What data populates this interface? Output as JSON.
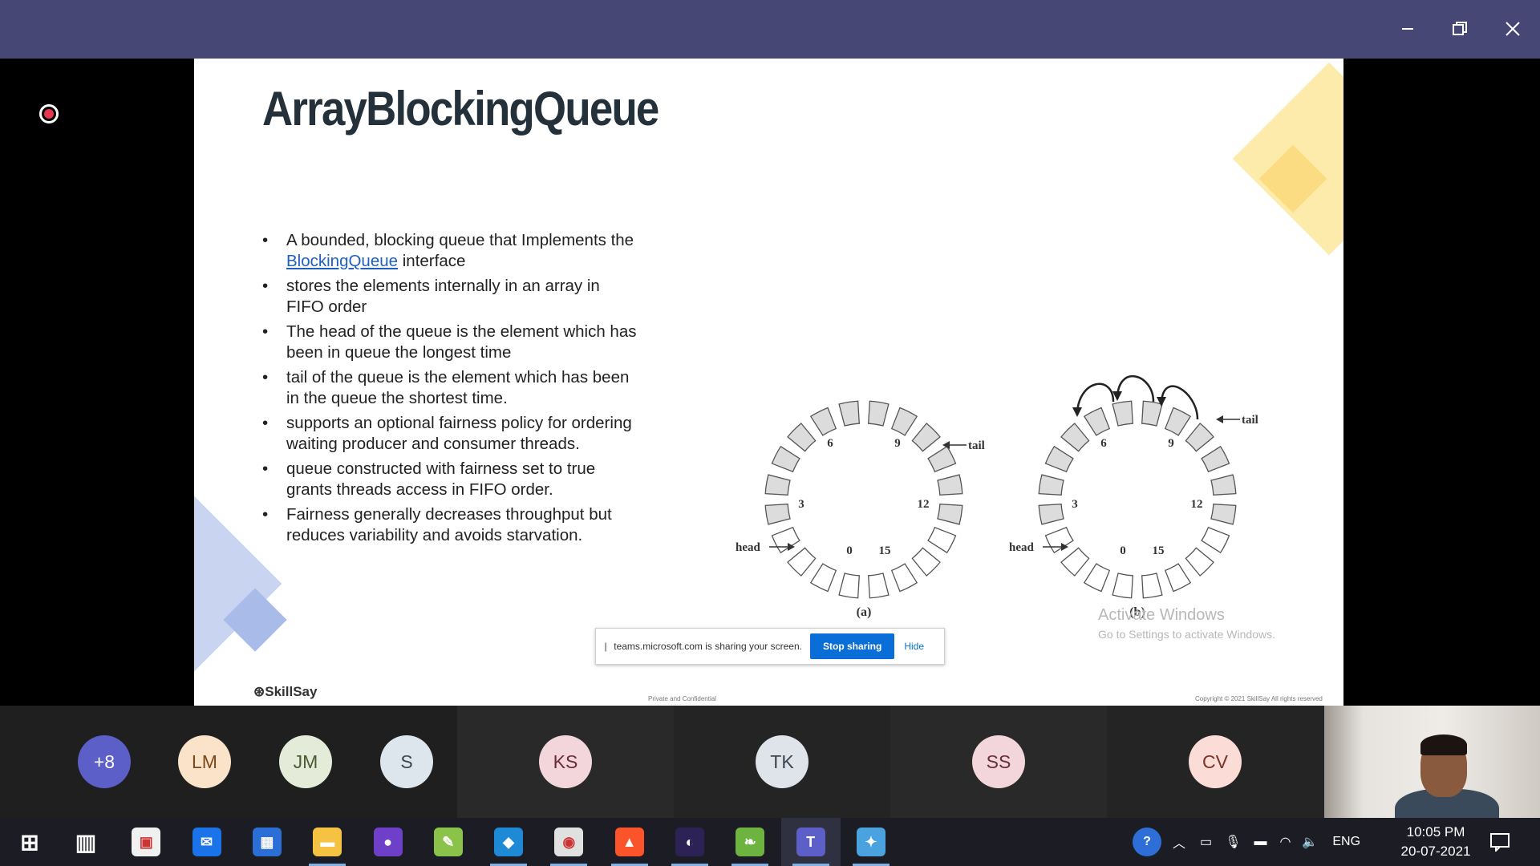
{
  "window": {
    "minimize_icon": "minimize-icon",
    "restore_icon": "restore-icon",
    "close_icon": "close-icon"
  },
  "slide": {
    "title": "ArrayBlockingQueue",
    "bullets": [
      {
        "pre": "A bounded, blocking queue that Implements the ",
        "link": "BlockingQueue",
        "post": " interface"
      },
      {
        "pre": "stores the elements internally in an array in FIFO order"
      },
      {
        "pre": "The head of the queue is the element which has been in queue the longest time"
      },
      {
        "pre": "tail of the queue is the element which has been in the queue the shortest time."
      },
      {
        "pre": "supports an optional fairness policy for ordering waiting producer and consumer threads."
      },
      {
        "pre": "queue constructed with fairness set to true grants threads access in FIFO order."
      },
      {
        "pre": "Fairness generally decreases throughput but reduces variability and avoids starvation."
      }
    ],
    "diagram": {
      "a": {
        "caption": "(a)",
        "head": "head",
        "tail": "tail",
        "numbers": [
          "6",
          "9",
          "3",
          "12",
          "0",
          "15"
        ]
      },
      "b": {
        "caption": "(b)",
        "head": "head",
        "tail": "tail",
        "numbers": [
          "6",
          "9",
          "3",
          "12",
          "0",
          "15"
        ]
      }
    },
    "brand": "SkillSay",
    "footer_mid": "Private and Confidential",
    "footer_right": "Copyright © 2021 SkillSay All rights reserved"
  },
  "watermark": {
    "line1": "Activate Windows",
    "line2": "Go to Settings to activate Windows."
  },
  "share_bar": {
    "message": "teams.microsoft.com is sharing your screen.",
    "stop_label": "Stop sharing",
    "hide_label": "Hide"
  },
  "participants": [
    {
      "initials": "+8",
      "bg": "#5b5fc7",
      "fg": "#ffffff"
    },
    {
      "initials": "LM",
      "bg": "#fbe3c9",
      "fg": "#7a4a1a"
    },
    {
      "initials": "JM",
      "bg": "#e4ecd9",
      "fg": "#4b5b33"
    },
    {
      "initials": "S",
      "bg": "#dde6ec",
      "fg": "#3a4650"
    },
    {
      "initials": "KS",
      "bg": "#f3d6dc",
      "fg": "#6a2b3a"
    },
    {
      "initials": "TK",
      "bg": "#dfe4ea",
      "fg": "#3a4550"
    },
    {
      "initials": "SS",
      "bg": "#f3d6dc",
      "fg": "#6a2b3a"
    },
    {
      "initials": "CV",
      "bg": "#fbdcd6",
      "fg": "#7a3326"
    }
  ],
  "taskbar": {
    "apps": [
      {
        "name": "start-icon"
      },
      {
        "name": "task-view-icon"
      },
      {
        "name": "store-icon"
      },
      {
        "name": "mail-icon"
      },
      {
        "name": "calendar-icon"
      },
      {
        "name": "file-explorer-icon"
      },
      {
        "name": "github-icon"
      },
      {
        "name": "notepad-icon"
      },
      {
        "name": "vscode-icon"
      },
      {
        "name": "chrome-icon"
      },
      {
        "name": "brave-icon"
      },
      {
        "name": "eclipse-icon"
      },
      {
        "name": "spring-icon"
      },
      {
        "name": "teams-icon"
      },
      {
        "name": "paint-icon"
      }
    ],
    "lang": "ENG",
    "time": "10:05 PM",
    "date": "20-07-2021"
  }
}
